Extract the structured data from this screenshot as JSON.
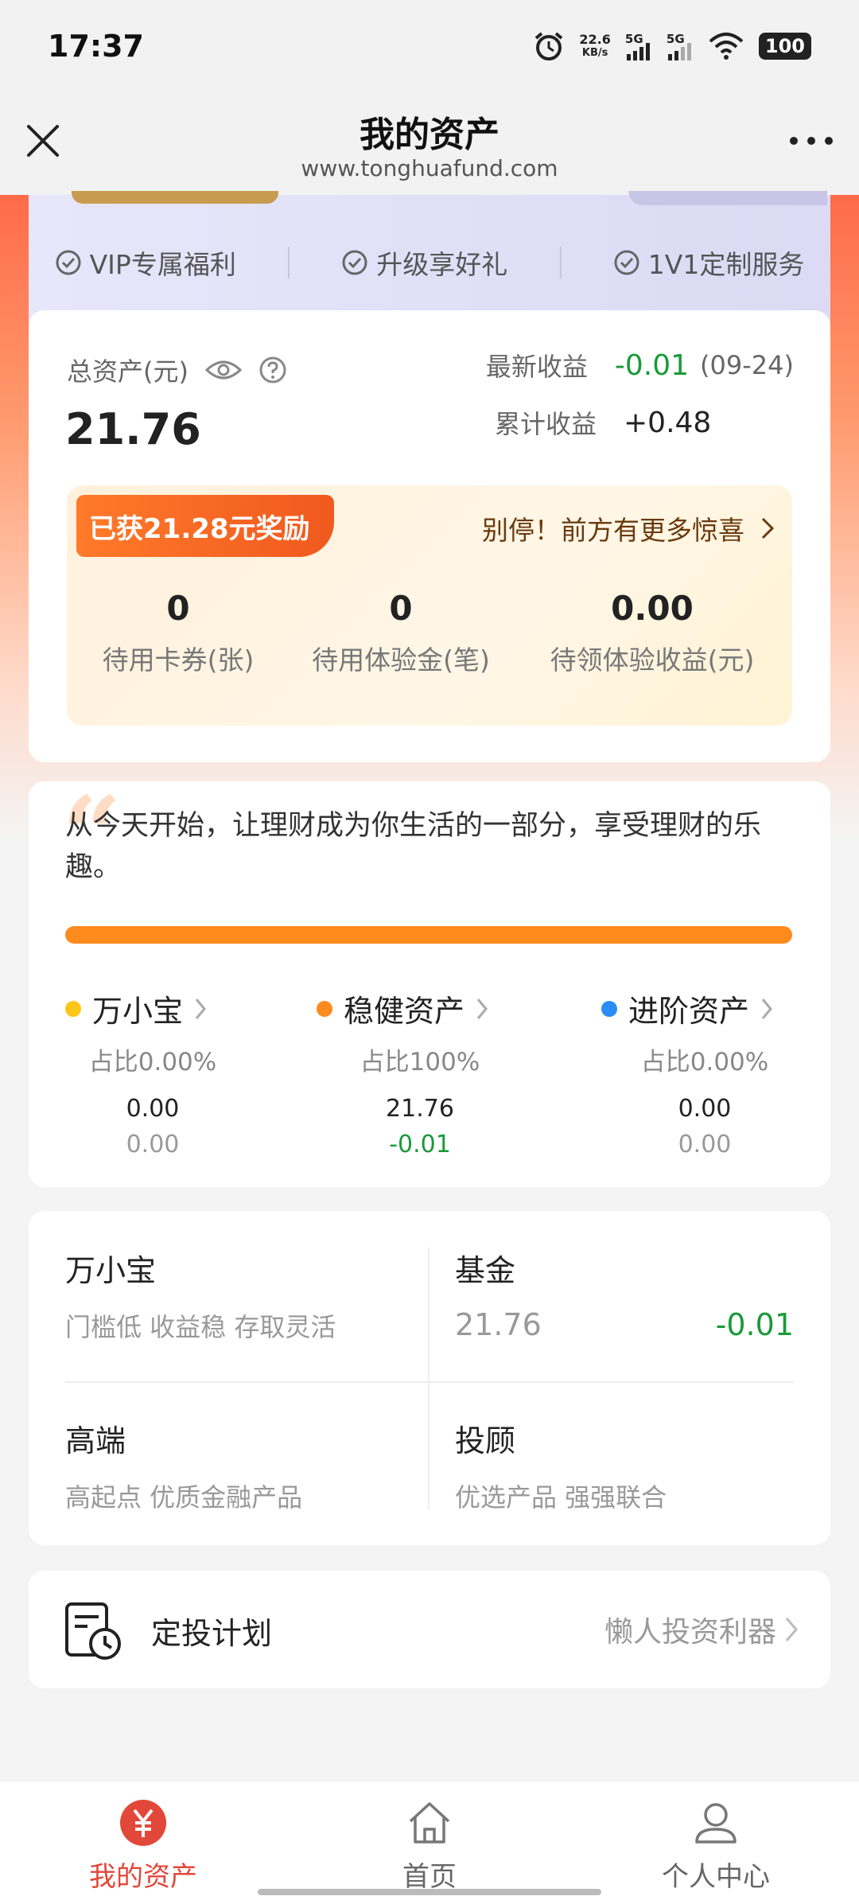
{
  "status_bar": {
    "time": "17:37",
    "net_speed_value": "22.6",
    "net_speed_unit": "KB/s",
    "signal1": "5G",
    "signal2": "5G",
    "battery": "100"
  },
  "nav": {
    "title": "我的资产",
    "url": "www.tonghuafund.com",
    "close_icon": "close-icon",
    "more_icon": "more-icon"
  },
  "vip_perks": [
    "VIP专属福利",
    "升级享好礼",
    "1V1定制服务"
  ],
  "assets": {
    "total_label": "总资产(元)",
    "total_value": "21.76",
    "latest_label": "最新收益",
    "latest_value": "-0.01",
    "latest_date": "(09-24)",
    "cumulative_label": "累计收益",
    "cumulative_value": "+0.48"
  },
  "reward": {
    "tag": "已获21.28元奖励",
    "hint": "别停！前方有更多惊喜",
    "stats": [
      {
        "value": "0",
        "label": "待用卡券(张)"
      },
      {
        "value": "0",
        "label": "待用体验金(笔)"
      },
      {
        "value": "0.00",
        "label": "待领体验收益(元)"
      }
    ]
  },
  "quote": {
    "mark": "“",
    "text": "从今天开始，让理财成为你生活的一部分，享受理财的乐趣。",
    "progress_fraction": 1.0
  },
  "allocations": [
    {
      "name": "万小宝",
      "pct": "占比0.00%",
      "v1": "0.00",
      "v2": "0.00",
      "color": "#ffc61a",
      "v2_color": "#999999"
    },
    {
      "name": "稳健资产",
      "pct": "占比100%",
      "v1": "21.76",
      "v2": "-0.01",
      "color": "#ff8a1e",
      "v2_color": "#1a9a3a"
    },
    {
      "name": "进阶资产",
      "pct": "占比0.00%",
      "v1": "0.00",
      "v2": "0.00",
      "color": "#2a8cf4",
      "v2_color": "#999999"
    }
  ],
  "products": {
    "wanxiaobao": {
      "title": "万小宝",
      "sub": "门槛低 收益稳 存取灵活"
    },
    "fund": {
      "title": "基金",
      "value": "21.76",
      "change": "-0.01"
    },
    "highend": {
      "title": "高端",
      "sub": "高起点 优质金融产品"
    },
    "advisor": {
      "title": "投顾",
      "sub": "优选产品 强强联合"
    }
  },
  "plan": {
    "title": "定投计划",
    "hint": "懒人投资利器"
  },
  "tabs": [
    {
      "label": "我的资产",
      "icon": "yuan-icon",
      "active": true
    },
    {
      "label": "首页",
      "icon": "home-icon",
      "active": false
    },
    {
      "label": "个人中心",
      "icon": "user-icon",
      "active": false
    }
  ],
  "colors": {
    "accent": "#ff8a1e",
    "red": "#e2483a",
    "green": "#1a9a3a"
  }
}
